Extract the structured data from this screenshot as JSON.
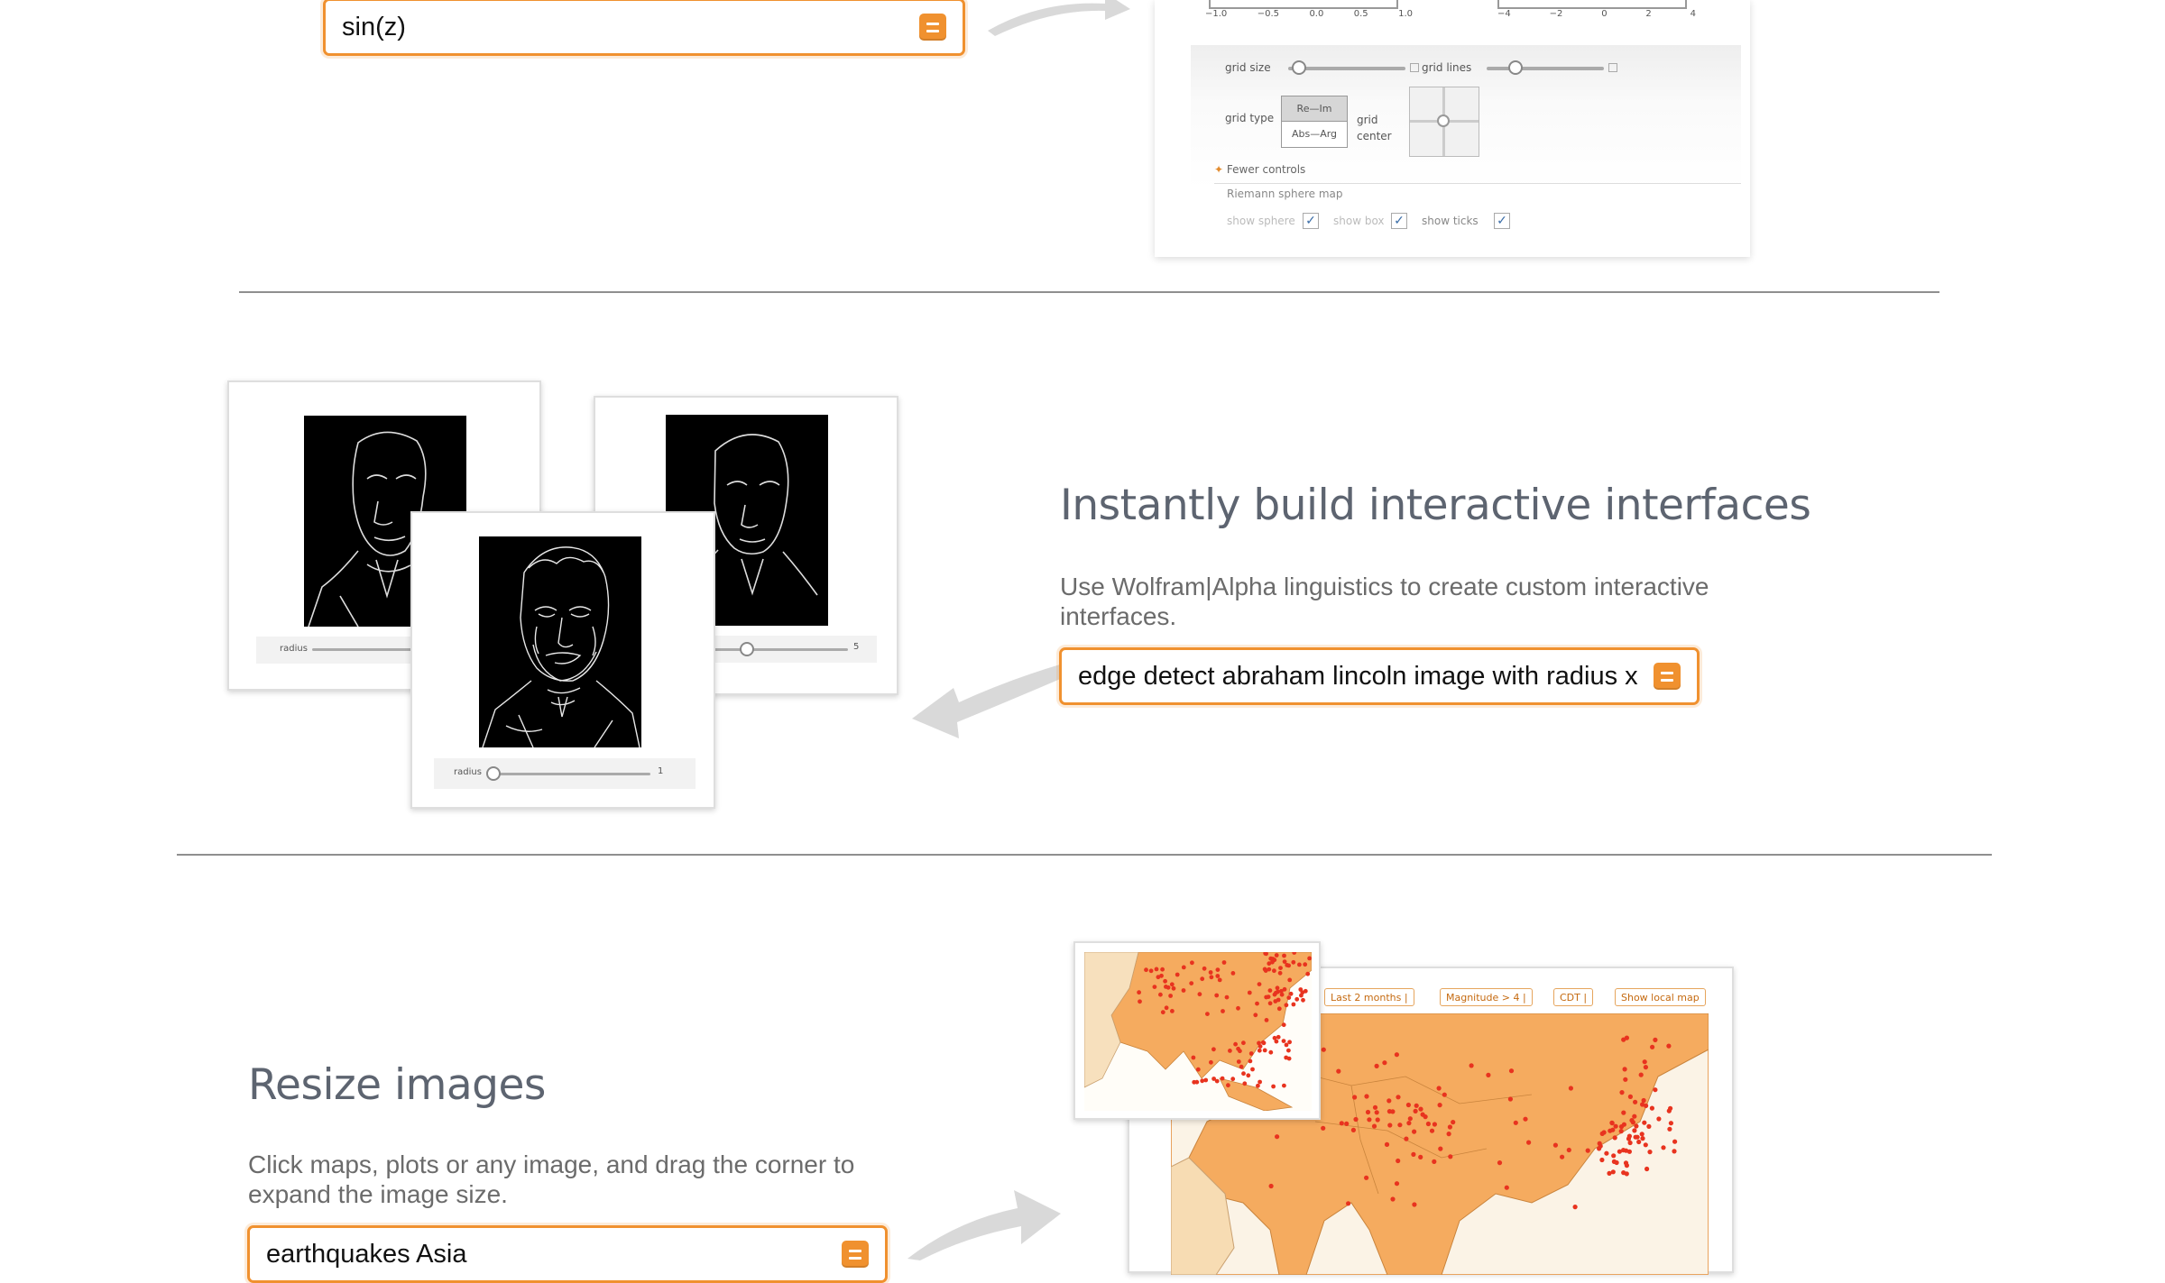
{
  "section_complex": {
    "input_value": "sin(z)",
    "axis_ticks_left": [
      "−1.0",
      "−0.5",
      "0.0",
      "0.5",
      "1.0"
    ],
    "axis_ticks_right": [
      "−4",
      "−2",
      "0",
      "2",
      "4"
    ],
    "grid_size_label": "grid size",
    "grid_lines_label": "grid lines",
    "grid_type_label": "grid type",
    "grid_type_options": [
      "Re—Im",
      "Abs—Arg"
    ],
    "grid_center_label": "grid center",
    "fewer_controls": "Fewer controls",
    "riemann_label": "Riemann sphere map",
    "show_sphere": "show sphere",
    "show_box": "show box",
    "show_ticks": "show ticks"
  },
  "section_interfaces": {
    "heading": "Instantly build interactive interfaces",
    "description": "Use Wolfram|Alpha linguistics to create custom interactive interfaces.",
    "input_value": "edge detect abraham lincoln image with radius x",
    "radius_label": "radius",
    "card_front_value": "1",
    "card_right_value": "5"
  },
  "section_resize": {
    "heading": "Resize images",
    "description": "Click maps, plots or any image, and drag the corner to expand the image size.",
    "input_value": "earthquakes Asia",
    "filters": [
      "Last 2 months |",
      "Magnitude > 4 |",
      "CDT |",
      "Show local map"
    ]
  },
  "colors": {
    "accent": "#f0912f",
    "land": "#f5ab5f",
    "quake": "#e8331f"
  }
}
